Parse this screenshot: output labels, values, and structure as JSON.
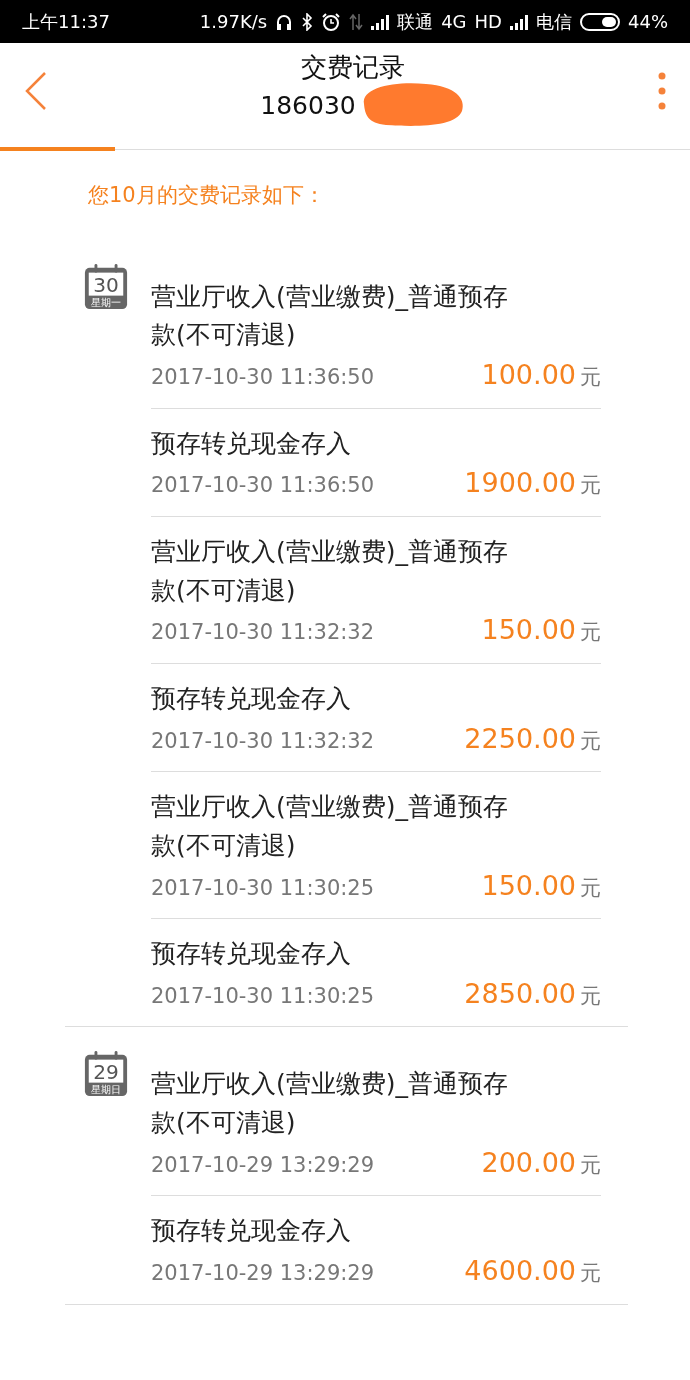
{
  "status_bar": {
    "time": "上午11:37",
    "speed": "1.97K/s",
    "carrier_1": "联通",
    "network": "4G",
    "hd": "HD",
    "carrier_2": "电信",
    "battery": "44%"
  },
  "header": {
    "title": "交费记录",
    "subtitle": "186030"
  },
  "summary": "您10月的交费记录如下：",
  "days": [
    {
      "day": "30",
      "weekday": "星期一",
      "records": [
        {
          "title": "营业厅收入(营业缴费)_普通预存款(不可清退)",
          "time": "2017-10-30 11:36:50",
          "amount": "100.00",
          "unit": "元"
        },
        {
          "title": "预存转兑现金存入",
          "time": "2017-10-30 11:36:50",
          "amount": "1900.00",
          "unit": "元"
        },
        {
          "title": "营业厅收入(营业缴费)_普通预存款(不可清退)",
          "time": "2017-10-30 11:32:32",
          "amount": "150.00",
          "unit": "元"
        },
        {
          "title": "预存转兑现金存入",
          "time": "2017-10-30 11:32:32",
          "amount": "2250.00",
          "unit": "元"
        },
        {
          "title": "营业厅收入(营业缴费)_普通预存款(不可清退)",
          "time": "2017-10-30 11:30:25",
          "amount": "150.00",
          "unit": "元"
        },
        {
          "title": "预存转兑现金存入",
          "time": "2017-10-30 11:30:25",
          "amount": "2850.00",
          "unit": "元"
        }
      ]
    },
    {
      "day": "29",
      "weekday": "星期日",
      "records": [
        {
          "title": "营业厅收入(营业缴费)_普通预存款(不可清退)",
          "time": "2017-10-29 13:29:29",
          "amount": "200.00",
          "unit": "元"
        },
        {
          "title": "预存转兑现金存入",
          "time": "2017-10-29 13:29:29",
          "amount": "4600.00",
          "unit": "元"
        }
      ]
    }
  ]
}
